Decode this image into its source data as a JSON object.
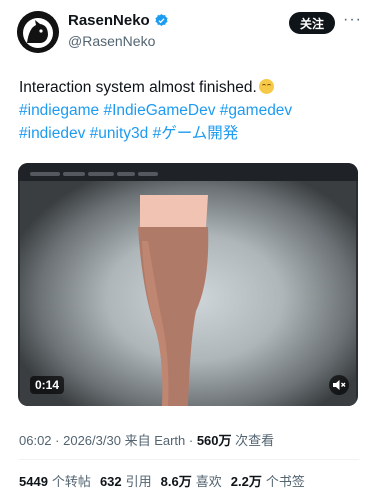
{
  "author": {
    "name": "RasenNeko",
    "handle": "@RasenNeko",
    "verified": true
  },
  "follow_button": {
    "label": "关注"
  },
  "more_menu": {
    "icon": "more-horizontal-icon"
  },
  "tweet": {
    "text": "Interaction system almost finished.",
    "emoji": "relieved-face-emoji",
    "hashtags_line1": [
      "#indiegame",
      "#IndieGameDev",
      "#gamedev"
    ],
    "hashtags_line2": [
      "#indiedev",
      "#unity3d",
      "#ゲーム開発"
    ]
  },
  "video": {
    "duration": "0:14",
    "mute_icon": "speaker-muted-icon"
  },
  "meta": {
    "time": "06:02",
    "date": "2026/3/30",
    "source": "来自 Earth",
    "views_count": "560万",
    "views_label": "次查看"
  },
  "stats": {
    "retweets_count": "5449",
    "retweets_label": "个转帖",
    "quotes_count": "632",
    "quotes_label": "引用",
    "likes_count": "8.6万",
    "likes_label": "喜欢",
    "bookmarks_count": "2.2万",
    "bookmarks_label": "个书签"
  },
  "colors": {
    "accent": "#1d9bf0",
    "text": "#0f1419",
    "muted": "#536471"
  }
}
